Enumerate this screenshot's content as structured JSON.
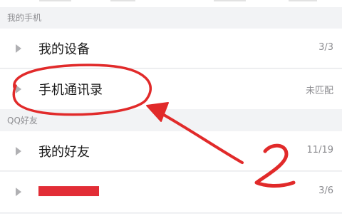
{
  "sections": [
    {
      "header": "我的手机",
      "rows": [
        {
          "title": "我的设备",
          "count": "3/3"
        },
        {
          "title": "手机通讯录",
          "count": "未匹配"
        }
      ]
    },
    {
      "header": "QQ好友",
      "rows": [
        {
          "title": "我的好友",
          "count": "11/19"
        },
        {
          "title": "",
          "count": "3/6"
        }
      ]
    }
  ],
  "annotation": {
    "text": "2",
    "color": "#e12a2a"
  }
}
